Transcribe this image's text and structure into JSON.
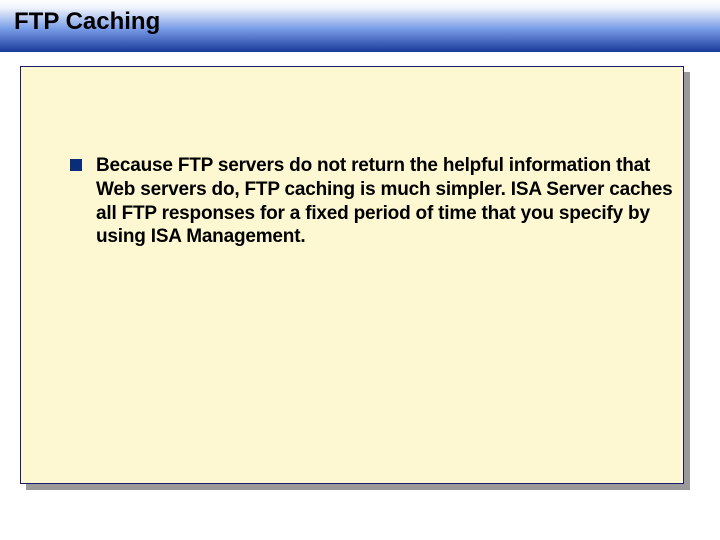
{
  "slide": {
    "title": "FTP Caching",
    "bullets": [
      {
        "text": "Because FTP servers do not return the helpful information that Web servers do, FTP caching is much simpler. ISA Server caches all FTP responses for a fixed period of time that you specify by using ISA Management."
      }
    ]
  }
}
